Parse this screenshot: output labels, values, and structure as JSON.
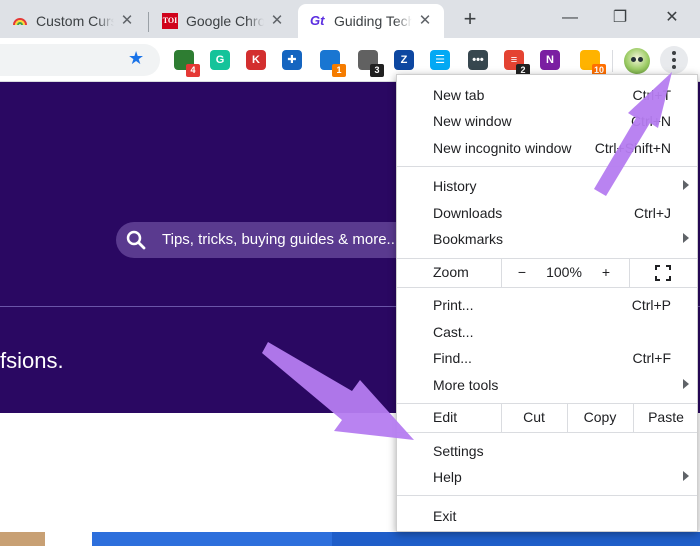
{
  "tabs": [
    {
      "title": "Custom Cursor for Chrome",
      "favicon": "rainbow-icon",
      "active": false
    },
    {
      "title": "Google Chrome",
      "favicon": "toi-icon",
      "favicon_text": "TOI",
      "active": false
    },
    {
      "title": "Guiding Tech",
      "favicon": "gt-icon",
      "favicon_text": "Gt",
      "active": true
    }
  ],
  "tab_close_glyph": "✕",
  "newtab_glyph": "+",
  "window_controls": {
    "minimize": "—",
    "restore": "❐",
    "close": "✕"
  },
  "toolbar": {
    "bookmark_glyph": "★",
    "extensions": [
      {
        "name": "green-extension-icon",
        "letter": "",
        "color": "#2e7d32",
        "badge": "4",
        "badge_color": "#e53935"
      },
      {
        "name": "grammarly-icon",
        "letter": "G",
        "color": "#15c39a",
        "badge": "",
        "badge_color": ""
      },
      {
        "name": "k-extension-icon",
        "letter": "K",
        "color": "#d32f2f",
        "badge": "",
        "badge_color": ""
      },
      {
        "name": "puzzle-blue-icon",
        "letter": "✚",
        "color": "#1565c0",
        "badge": "",
        "badge_color": ""
      },
      {
        "name": "blue-square-icon",
        "letter": "",
        "color": "#1976d2",
        "badge": "1",
        "badge_color": "#f57c00"
      },
      {
        "name": "evernote-icon",
        "letter": "",
        "color": "#616161",
        "badge": "3",
        "badge_color": "#212121"
      },
      {
        "name": "z-extension-icon",
        "letter": "Z",
        "color": "#0d47a1",
        "badge": "",
        "badge_color": ""
      },
      {
        "name": "filter-icon",
        "letter": "☰",
        "color": "#03a9f4",
        "badge": "",
        "badge_color": ""
      },
      {
        "name": "dots-extension-icon",
        "letter": "•••",
        "color": "#37474f",
        "badge": "",
        "badge_color": ""
      },
      {
        "name": "todoist-icon",
        "letter": "≡",
        "color": "#e44332",
        "badge": "2",
        "badge_color": "#212121"
      },
      {
        "name": "onenote-icon",
        "letter": "N",
        "color": "#7b1fa2",
        "badge": "",
        "badge_color": ""
      },
      {
        "name": "colorful-extension-icon",
        "letter": "",
        "color": "#ffb300",
        "badge": "10",
        "badge_color": "#ff6f00"
      }
    ]
  },
  "page": {
    "search_placeholder": "Tips, tricks, buying guides & more...",
    "hero_text": "fsions."
  },
  "menu": {
    "new_tab": {
      "label": "New tab",
      "shortcut": "Ctrl+T"
    },
    "new_window": {
      "label": "New window",
      "shortcut": "Ctrl+N"
    },
    "new_incognito": {
      "label": "New incognito window",
      "shortcut": "Ctrl+Shift+N"
    },
    "history": {
      "label": "History"
    },
    "downloads": {
      "label": "Downloads",
      "shortcut": "Ctrl+J"
    },
    "bookmarks": {
      "label": "Bookmarks"
    },
    "zoom": {
      "label": "Zoom",
      "minus": "−",
      "value": "100%",
      "plus": "+"
    },
    "print": {
      "label": "Print...",
      "shortcut": "Ctrl+P"
    },
    "cast": {
      "label": "Cast..."
    },
    "find": {
      "label": "Find...",
      "shortcut": "Ctrl+F"
    },
    "more_tools": {
      "label": "More tools"
    },
    "edit": {
      "label": "Edit",
      "cut": "Cut",
      "copy": "Copy",
      "paste": "Paste"
    },
    "settings": {
      "label": "Settings"
    },
    "help": {
      "label": "Help"
    },
    "exit": {
      "label": "Exit"
    }
  },
  "colors": {
    "accent": "#1a73e8",
    "hero": "#2a0862",
    "annotation_arrow": "#b57cf0"
  }
}
